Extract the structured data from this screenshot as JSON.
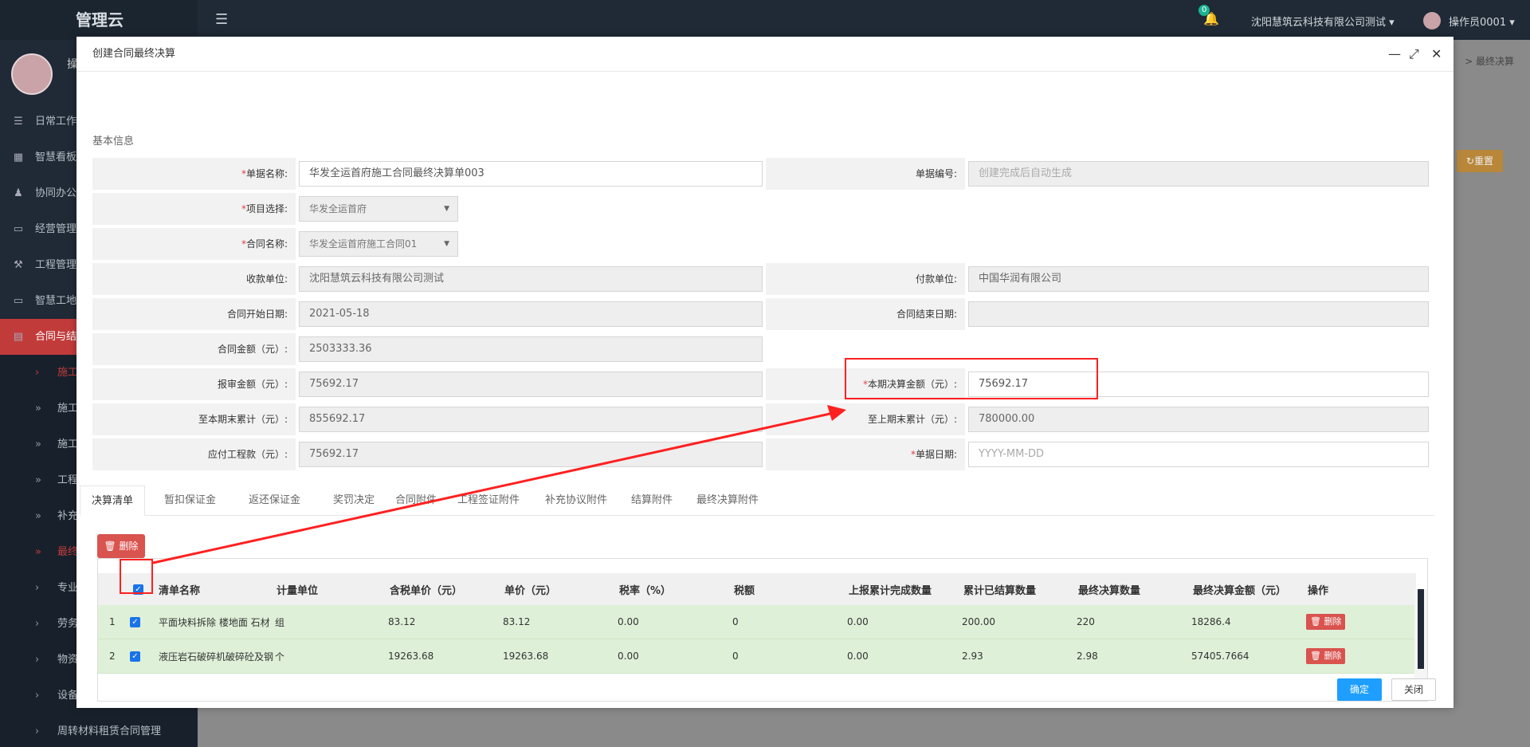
{
  "app": {
    "brand": "管理云",
    "company": "沈阳慧筑云科技有限公司测试",
    "operator": "操作员0001",
    "notifications": "0",
    "user_short": "操"
  },
  "breadcrumb": "> 最终决算",
  "reset_label": "重置",
  "sidebar": {
    "items": [
      {
        "label": "日常工作",
        "icon": "list-icon"
      },
      {
        "label": "智慧看板",
        "icon": "dashboard-icon"
      },
      {
        "label": "协同办公",
        "icon": "users-icon"
      },
      {
        "label": "经营管理",
        "icon": "monitor-icon"
      },
      {
        "label": "工程管理",
        "icon": "hammer-icon"
      },
      {
        "label": "智慧工地",
        "icon": "monitor-icon"
      },
      {
        "label": "合同与结",
        "icon": "file-icon"
      }
    ],
    "subitems": [
      {
        "label": "施工"
      },
      {
        "label": "施工"
      },
      {
        "label": "施工"
      },
      {
        "label": "工程"
      },
      {
        "label": "补充"
      },
      {
        "label": "最终"
      },
      {
        "label": "专业"
      },
      {
        "label": "劳务"
      },
      {
        "label": "物资"
      },
      {
        "label": "设备租赁合同管理"
      },
      {
        "label": "周转材料租赁合同管理"
      }
    ]
  },
  "modal": {
    "title": "创建合同最终决算",
    "section": "基本信息",
    "fields": {
      "doc_name_label": "单据名称:",
      "doc_name_value": "华发全运首府施工合同最终决算单003",
      "doc_no_label": "单据编号:",
      "doc_no_placeholder": "创建完成后自动生成",
      "project_label": "项目选择:",
      "project_value": "华发全运首府",
      "contract_label": "合同名称:",
      "contract_value": "华发全运首府施工合同01",
      "payee_label": "收款单位:",
      "payee_value": "沈阳慧筑云科技有限公司测试",
      "payer_label": "付款单位:",
      "payer_value": "中国华润有限公司",
      "start_label": "合同开始日期:",
      "start_value": "2021-05-18",
      "end_label": "合同结束日期:",
      "end_value": "",
      "amount_label": "合同金额（元）:",
      "amount_value": "2503333.36",
      "reported_label": "报审金额（元）:",
      "reported_value": "75692.17",
      "period_label": "本期决算金额（元）:",
      "period_value": "75692.17",
      "cum_label": "至本期末累计（元）:",
      "cum_value": "855692.17",
      "prev_cum_label": "至上期末累计（元）:",
      "prev_cum_value": "780000.00",
      "payable_label": "应付工程款（元）:",
      "payable_value": "75692.17",
      "date_label": "单据日期:",
      "date_placeholder": "YYYY-MM-DD"
    },
    "tabs": [
      "决算清单",
      "暂扣保证金",
      "返还保证金",
      "奖罚决定",
      "合同附件",
      "工程签证附件",
      "补充协议附件",
      "结算附件",
      "最终决算附件"
    ],
    "delete_label": "删除",
    "table": {
      "headers": [
        "清单名称",
        "计量单位",
        "含税单价（元）",
        "单价（元）",
        "税率（%）",
        "税额",
        "上报累计完成数量",
        "累计已结算数量",
        "最终决算数量",
        "最终决算金额（元）",
        "操作"
      ],
      "rows": [
        {
          "idx": "1",
          "name": "平面块料拆除 楼地面 石材",
          "unit": "组",
          "tax_price": "83.12",
          "price": "83.12",
          "rate": "0.00",
          "tax": "0",
          "reported": "0.00",
          "settled": "200.00",
          "final_qty": "220",
          "final_amt": "18286.4",
          "op": "删除"
        },
        {
          "idx": "2",
          "name": "液压岩石破碎机破碎砼及钢",
          "unit": "个",
          "tax_price": "19263.68",
          "price": "19263.68",
          "rate": "0.00",
          "tax": "0",
          "reported": "0.00",
          "settled": "2.93",
          "final_qty": "2.98",
          "final_amt": "57405.7664",
          "op": "删除"
        }
      ]
    },
    "ok_label": "确定",
    "close_label": "关闭"
  }
}
